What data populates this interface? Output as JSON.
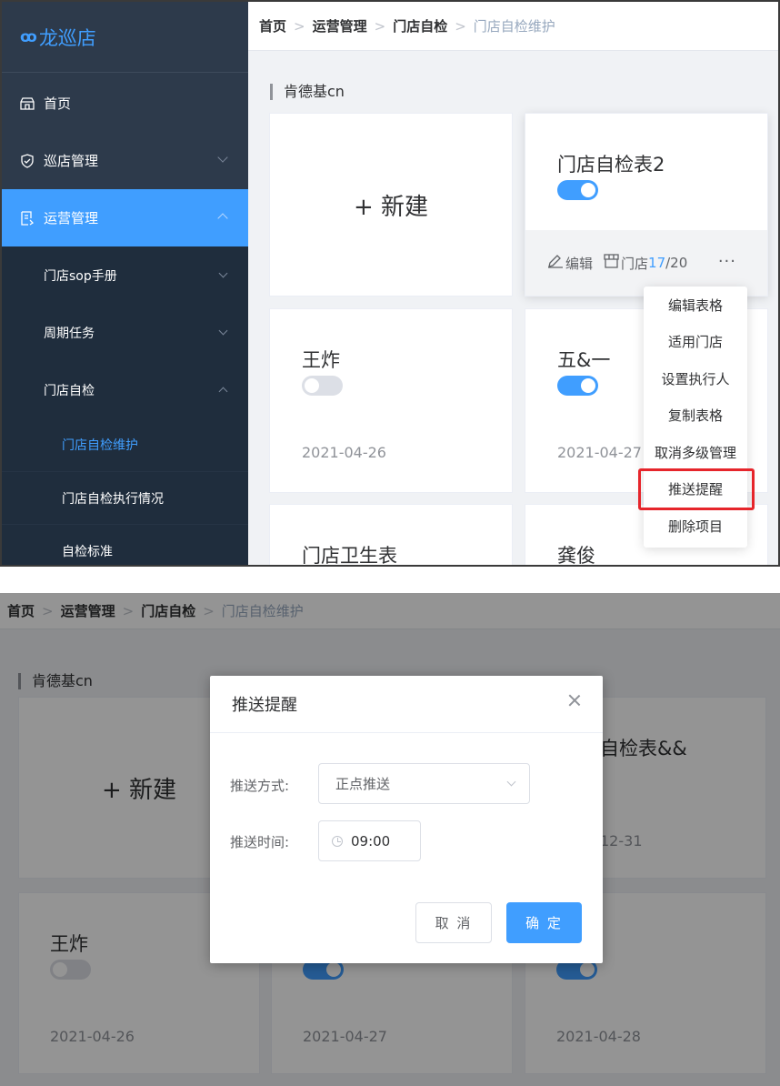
{
  "sidebar": {
    "logo_mark": "ꝏ",
    "logo": "龙巡店",
    "items": [
      {
        "label": "首页"
      },
      {
        "label": "巡店管理"
      },
      {
        "label": "运营管理"
      }
    ],
    "sub_items": [
      {
        "label": "门店sop手册"
      },
      {
        "label": "周期任务"
      },
      {
        "label": "门店自检"
      }
    ],
    "leaf_items": [
      {
        "label": "门店自检维护"
      },
      {
        "label": "门店自检执行情况"
      },
      {
        "label": "自检标准"
      }
    ]
  },
  "breadcrumb": {
    "items": [
      "首页",
      "运营管理",
      "门店自检"
    ],
    "current": "门店自检维护",
    "sep": ">"
  },
  "group": "肯德基cn",
  "new_card": "+ 新建",
  "cards": [
    {
      "title": "门店自检表2",
      "enabled": true
    },
    {
      "title": "王炸",
      "enabled": false,
      "date": "2021-04-26"
    },
    {
      "title": "五&一",
      "enabled": true,
      "date": "2021-04-27"
    },
    {
      "title": "门店卫生表"
    },
    {
      "title": "龚俊"
    }
  ],
  "card_footer": {
    "edit": "编辑",
    "store_label": "门店",
    "store_count": "17",
    "store_total": "/20",
    "more": "···"
  },
  "context_menu": [
    "编辑表格",
    "适用门店",
    "设置执行人",
    "复制表格",
    "取消多级管理",
    "推送提醒",
    "删除项目"
  ],
  "screen2": {
    "bg_cards": [
      {
        "title": "王炸",
        "date": "2021-04-26"
      },
      {
        "date": "2021-04-27"
      },
      {
        "date": "2021-04-28"
      }
    ],
    "bg_partial_title": "自检表&&",
    "bg_partial_date": "12-31",
    "dialog": {
      "title": "推送提醒",
      "method_label": "推送方式:",
      "method_value": "正点推送",
      "time_label": "推送时间:",
      "time_value": "09:00",
      "cancel": "取 消",
      "confirm": "确 定"
    }
  },
  "colors": {
    "accent": "#409eff",
    "sidebar": "#2d3a4b",
    "highlight_box": "#e6252b"
  }
}
